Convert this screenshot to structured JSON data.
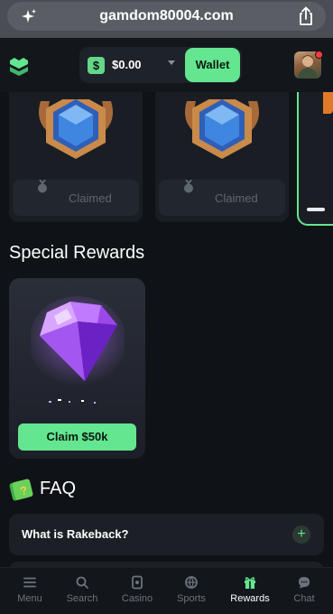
{
  "browser": {
    "url": "gamdom80004.com"
  },
  "header": {
    "balance": "$0.00",
    "currency_symbol": "$",
    "wallet_label": "Wallet"
  },
  "badges": [
    {
      "status": "Claimed"
    },
    {
      "status": "Claimed"
    }
  ],
  "special_rewards": {
    "title": "Special Rewards",
    "card": {
      "button_label": "Claim  $50k"
    }
  },
  "faq": {
    "title": "FAQ",
    "items": [
      {
        "question": "What is Rakeback?",
        "expand_symbol": "+"
      }
    ]
  },
  "nav": {
    "items": [
      {
        "label": "Menu",
        "icon": "menu-icon"
      },
      {
        "label": "Search",
        "icon": "search-icon"
      },
      {
        "label": "Casino",
        "icon": "casino-icon"
      },
      {
        "label": "Sports",
        "icon": "sports-icon"
      },
      {
        "label": "Rewards",
        "icon": "gift-icon"
      },
      {
        "label": "Chat",
        "icon": "chat-icon"
      }
    ],
    "active": "Rewards"
  },
  "colors": {
    "accent": "#63e68f",
    "background": "#0f1216",
    "card": "#1a1e24",
    "notification": "#ff3b3b"
  }
}
